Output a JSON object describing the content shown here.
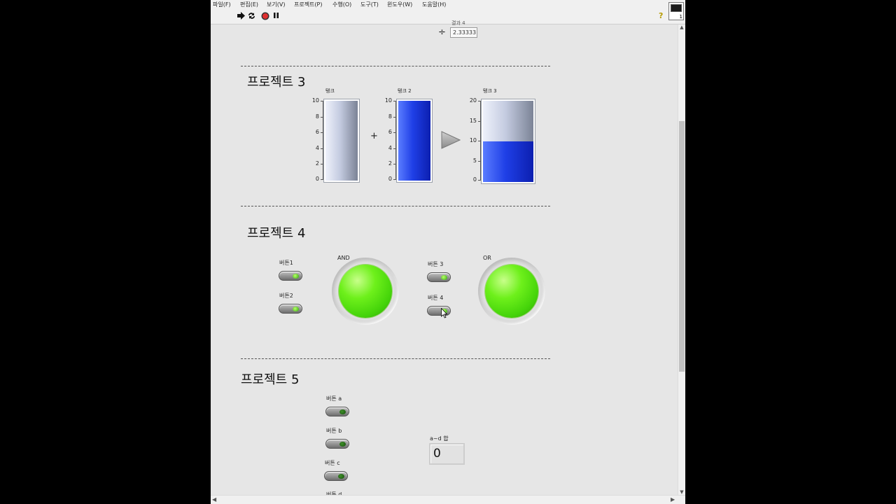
{
  "menu": [
    "파일(F)",
    "편집(E)",
    "보기(V)",
    "프로젝트(P)",
    "수행(O)",
    "도구(T)",
    "윈도우(W)",
    "도움말(H)"
  ],
  "toolbar": {
    "run_icon": "run-arrow-icon",
    "run_continuous_icon": "run-continuously-icon",
    "abort_icon": "abort-stop-icon",
    "pause_icon": "pause-icon",
    "help_icon": "context-help-icon",
    "help_glyph": "?"
  },
  "vi_icon": {
    "number": "1"
  },
  "project2_tail": {
    "cut_label": "결과 4",
    "divide_symbol": "÷",
    "result_value": "2.33333"
  },
  "project3": {
    "title": "프로젝트 3",
    "tank1": {
      "label": "탱크",
      "value": 0,
      "max": 10,
      "ticks": [
        "10",
        "8",
        "6",
        "4",
        "2",
        "0"
      ]
    },
    "plus_symbol": "+",
    "tank2": {
      "label": "탱크 2",
      "value": 10,
      "max": 10,
      "ticks": [
        "10",
        "8",
        "6",
        "4",
        "2",
        "0"
      ]
    },
    "tank3": {
      "label": "탱크 3",
      "value": 10,
      "max": 20,
      "ticks": [
        "20",
        "15",
        "10",
        "5",
        "0"
      ]
    }
  },
  "project4": {
    "title": "프로젝트 4",
    "button1": {
      "label": "버튼1",
      "on": true
    },
    "button2": {
      "label": "버튼2",
      "on": true
    },
    "and_led": {
      "label": "AND",
      "on": true
    },
    "button3": {
      "label": "버튼 3",
      "on": true
    },
    "button4": {
      "label": "버튼 4",
      "on": true
    },
    "or_led": {
      "label": "OR",
      "on": true
    }
  },
  "project5": {
    "title": "프로젝트 5",
    "button_a": {
      "label": "버튼 a",
      "on": false
    },
    "button_b": {
      "label": "버튼 b",
      "on": false
    },
    "button_c": {
      "label": "버튼 c",
      "on": false
    },
    "button_d": {
      "label": "버튼 d"
    },
    "sum_label": "a~d 합",
    "sum_value": "0"
  },
  "colors": {
    "led_on": "#45d40a",
    "tank_fill": "#1f3fe6",
    "background": "#e6e6e6"
  }
}
